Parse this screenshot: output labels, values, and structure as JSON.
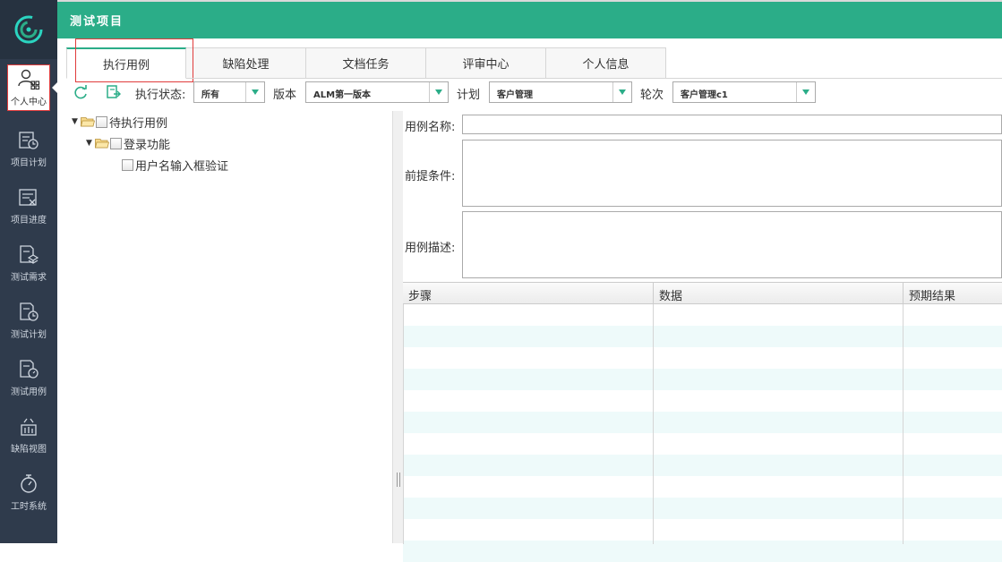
{
  "header": {
    "title": "测试项目"
  },
  "sidebar": {
    "items": [
      {
        "label": "个人中心",
        "icon": "user-group-icon"
      },
      {
        "label": "项目计划",
        "icon": "calendar-clock-icon"
      },
      {
        "label": "项目进度",
        "icon": "progress-chart-icon"
      },
      {
        "label": "测试需求",
        "icon": "layers-doc-icon"
      },
      {
        "label": "测试计划",
        "icon": "doc-clock-icon"
      },
      {
        "label": "测试用例",
        "icon": "doc-timer-icon"
      },
      {
        "label": "缺陷视图",
        "icon": "bug-chart-icon"
      },
      {
        "label": "工时系统",
        "icon": "stopwatch-icon"
      }
    ]
  },
  "tabs": [
    {
      "label": "执行用例"
    },
    {
      "label": "缺陷处理"
    },
    {
      "label": "文档任务"
    },
    {
      "label": "评审中心"
    },
    {
      "label": "个人信息"
    }
  ],
  "toolbar": {
    "status_label": "执行状态:",
    "status_value": "所有",
    "version_label": "版本",
    "version_value": "ALM第一版本",
    "plan_label": "计划",
    "plan_value": "客户管理",
    "round_label": "轮次",
    "round_value": "客户管理c1"
  },
  "tree": {
    "root": "待执行用例",
    "child": "登录功能",
    "leaf": "用户名输入框验证"
  },
  "form": {
    "name_label": "用例名称:",
    "precondition_label": "前提条件:",
    "description_label": "用例描述:"
  },
  "grid": {
    "columns": [
      "步骤",
      "数据",
      "预期结果"
    ]
  },
  "colors": {
    "accent": "#2bad88",
    "sidebar": "#2f3b4c",
    "highlight": "#e03c3c"
  }
}
